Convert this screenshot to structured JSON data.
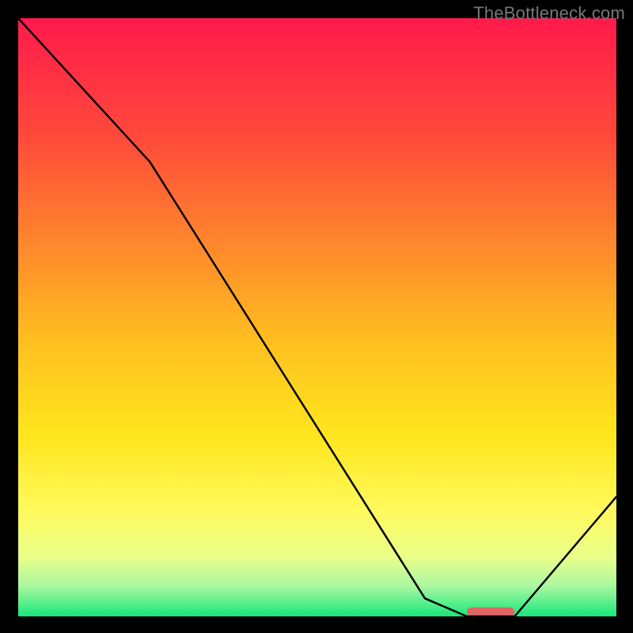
{
  "watermark": "TheBottleneck.com",
  "chart_data": {
    "type": "line",
    "title": "",
    "xlabel": "",
    "ylabel": "",
    "xlim": [
      0,
      100
    ],
    "ylim": [
      0,
      100
    ],
    "grid": false,
    "legend": null,
    "background_gradient": {
      "stops": [
        {
          "offset": 0.0,
          "color": "#ff1a4b"
        },
        {
          "offset": 0.2,
          "color": "#ff4a3a"
        },
        {
          "offset": 0.4,
          "color": "#ff8f2a"
        },
        {
          "offset": 0.55,
          "color": "#ffc21f"
        },
        {
          "offset": 0.7,
          "color": "#ffe61e"
        },
        {
          "offset": 0.82,
          "color": "#fff95a"
        },
        {
          "offset": 0.9,
          "color": "#eaff8a"
        },
        {
          "offset": 0.95,
          "color": "#a8f7a0"
        },
        {
          "offset": 1.0,
          "color": "#17e87b"
        }
      ]
    },
    "series": [
      {
        "name": "bottleneck-curve",
        "color": "#000000",
        "x": [
          0,
          22,
          68,
          75,
          83,
          100
        ],
        "values": [
          100,
          76,
          3,
          0,
          0,
          20
        ]
      }
    ],
    "marker": {
      "name": "optimal-range-pill",
      "color": "#e06666",
      "x_start": 75,
      "x_end": 83,
      "y": 0,
      "height_pct": 1.5
    }
  }
}
